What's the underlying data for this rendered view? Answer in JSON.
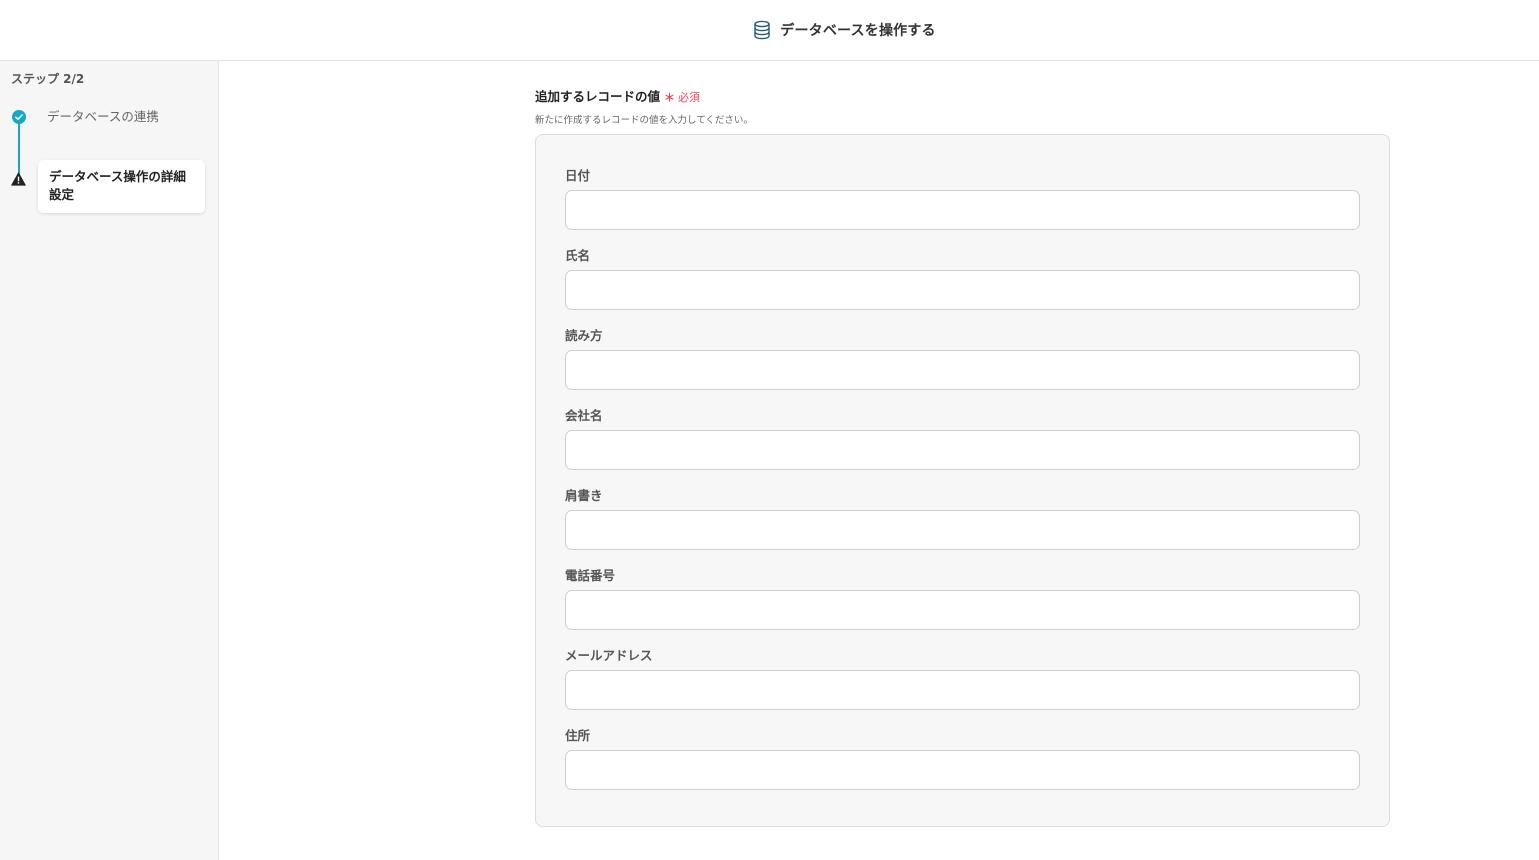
{
  "header": {
    "title": "データベースを操作する",
    "icon": "database-icon"
  },
  "sidebar": {
    "step_count": "ステップ 2/2",
    "steps": [
      {
        "label": "データベースの連携",
        "status": "completed"
      },
      {
        "label": "データベース操作の詳細設定",
        "status": "warning"
      }
    ]
  },
  "section": {
    "title": "追加するレコードの値",
    "required_star": "＊",
    "required_text": "必須",
    "description": "新たに作成するレコードの値を入力してください。"
  },
  "fields": [
    {
      "label": "日付",
      "value": ""
    },
    {
      "label": "氏名",
      "value": ""
    },
    {
      "label": "読み方",
      "value": ""
    },
    {
      "label": "会社名",
      "value": ""
    },
    {
      "label": "肩書き",
      "value": ""
    },
    {
      "label": "電話番号",
      "value": ""
    },
    {
      "label": "メールアドレス",
      "value": ""
    },
    {
      "label": "住所",
      "value": ""
    }
  ],
  "colors": {
    "accent": "#14a8c3",
    "required": "#e8475f",
    "warning": "#222222"
  }
}
